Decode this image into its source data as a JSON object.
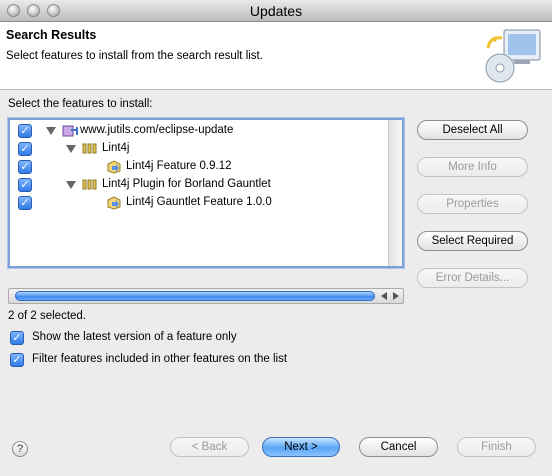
{
  "window": {
    "title": "Updates"
  },
  "header": {
    "title": "Search Results",
    "description": "Select features to install from the search result list."
  },
  "tree": {
    "label": "Select the features to install:",
    "items": [
      {
        "text": "www.jutils.com/eclipse-update",
        "checked": true,
        "level": 0,
        "type": "site"
      },
      {
        "text": "Lint4j",
        "checked": true,
        "level": 1,
        "type": "category"
      },
      {
        "text": "Lint4j Feature 0.9.12",
        "checked": true,
        "level": 2,
        "type": "feature"
      },
      {
        "text": "Lint4j Plugin for Borland Gauntlet",
        "checked": true,
        "level": 1,
        "type": "category"
      },
      {
        "text": "Lint4j Gauntlet Feature 1.0.0",
        "checked": true,
        "level": 2,
        "type": "feature"
      }
    ]
  },
  "side_buttons": {
    "deselect_all": "Deselect All",
    "more_info": "More Info",
    "properties": "Properties",
    "select_required": "Select Required",
    "error_details": "Error Details..."
  },
  "status_text": "2 of 2 selected.",
  "options": {
    "latest_version": "Show the latest version of a feature only",
    "filter_included": "Filter features included in other features on the list"
  },
  "footer": {
    "help_glyph": "?",
    "back": "< Back",
    "next": "Next >",
    "cancel": "Cancel",
    "finish": "Finish"
  },
  "colors": {
    "accent": "#3f8cf0",
    "focus_ring": "#7ea0d6"
  }
}
